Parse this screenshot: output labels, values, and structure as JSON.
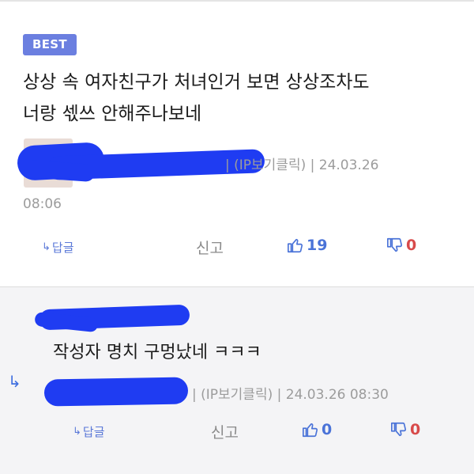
{
  "best_comment": {
    "badge": "BEST",
    "text_line1": "상상 속 여자친구가 처녀인거 보면 상상조차도",
    "text_line2": "너랑 섻쓰 안해주나보네",
    "meta_line1": "| (IP보기클릭) | 24.03.26",
    "meta_line2": "08:06",
    "actions": {
      "reply_label": "답글",
      "report_label": "신고",
      "upvotes": "19",
      "downvotes": "0"
    }
  },
  "reply_comment": {
    "text": "작성자 명치 구멍났네 ㅋㅋㅋ",
    "meta": "| (IP보기클릭) | 24.03.26 08:30",
    "actions": {
      "reply_label": "답글",
      "report_label": "신고",
      "upvotes": "0",
      "downvotes": "0"
    }
  },
  "icons": {
    "reply_arrow": "reply-arrow-icon",
    "thumbs_up": "thumbs-up-icon",
    "thumbs_down": "thumbs-down-icon",
    "nested_reply": "nested-reply-arrow-icon"
  },
  "colors": {
    "badge": "#6b7fe0",
    "link": "#5b79d8",
    "upvote": "#4a73d8",
    "downvote": "#d84a4a",
    "redaction": "#1f3cf2"
  }
}
